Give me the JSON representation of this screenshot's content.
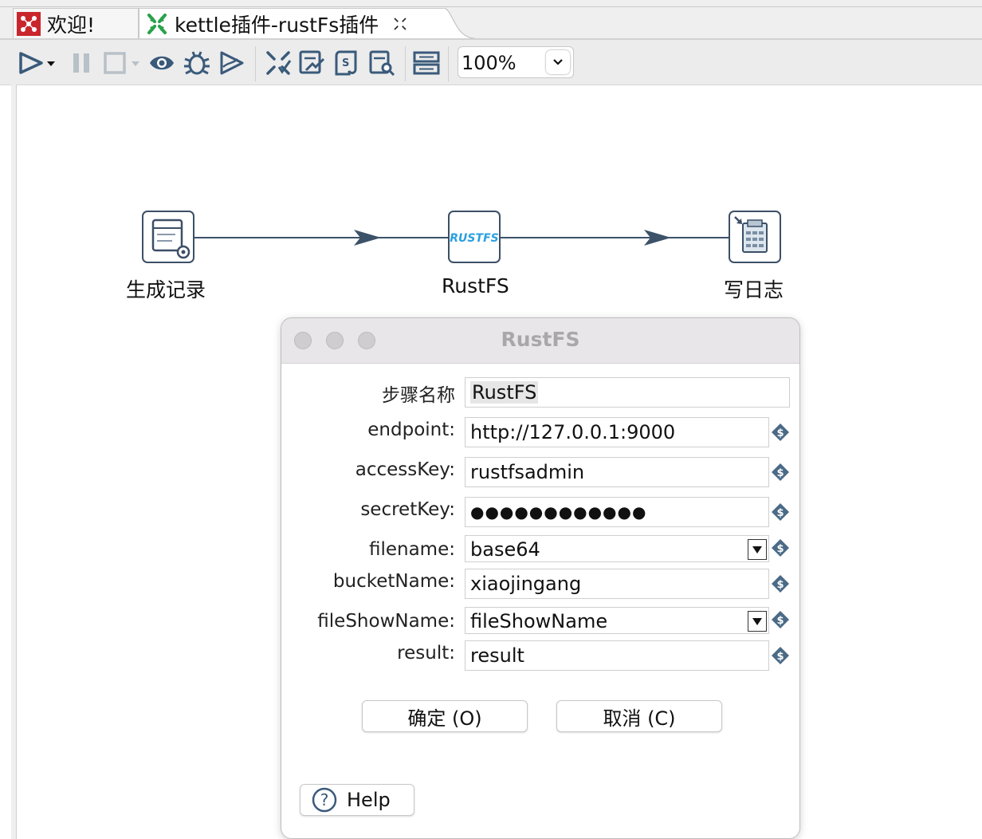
{
  "tabs": [
    {
      "label": "欢迎!",
      "icon": "kettle-welcome-icon",
      "active": false
    },
    {
      "label": "kettle插件-rustFs插件",
      "icon": "transformation-icon",
      "active": true,
      "close_icon": "close-icon"
    }
  ],
  "toolbar": {
    "icons": [
      "run-icon",
      "run-dropdown-icon",
      "pause-icon",
      "stop-icon",
      "stop-dropdown-icon",
      "preview-icon",
      "debug-icon",
      "replay-icon",
      "verify-icon",
      "analyze-impact-icon",
      "generate-sql-icon",
      "database-explore-icon",
      "grid-layout-icon"
    ],
    "zoom": "100%"
  },
  "canvas": {
    "steps": [
      {
        "label": "生成记录",
        "icon": "generate-rows-icon"
      },
      {
        "label": "RustFS",
        "icon": "rustfs-logo-icon",
        "logo_text": "RUSTFS"
      },
      {
        "label": "写日志",
        "icon": "write-log-icon"
      }
    ]
  },
  "dialog": {
    "title": "RustFS",
    "fields": {
      "step_name": {
        "label": "步骤名称",
        "value": "RustFS"
      },
      "endpoint": {
        "label": "endpoint:",
        "value": "http://127.0.0.1:9000"
      },
      "access_key": {
        "label": "accessKey:",
        "value": "rustfsadmin"
      },
      "secret_key": {
        "label": "secretKey:",
        "value": "●●●●●●●●●●●●"
      },
      "filename": {
        "label": "filename:",
        "value": "base64"
      },
      "bucket_name": {
        "label": "bucketName:",
        "value": "xiaojingang"
      },
      "file_show_name": {
        "label": "fileShowName:",
        "value": "fileShowName"
      },
      "result": {
        "label": "result:",
        "value": "result"
      }
    },
    "ok_label": "确定 (O)",
    "cancel_label": "取消 (C)",
    "help_label": "Help",
    "colors": {
      "variable_icon": "#4a6a86",
      "hop_line": "#3c5268"
    }
  }
}
